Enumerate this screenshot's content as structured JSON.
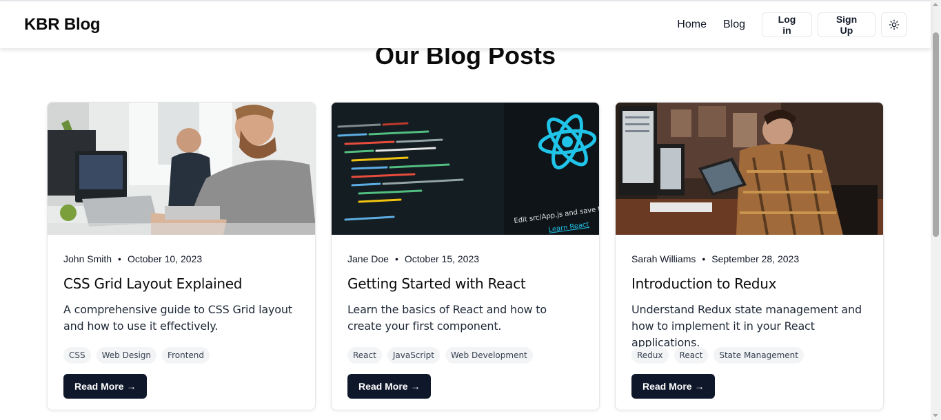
{
  "navbar": {
    "brand": "KBR Blog",
    "links": [
      "Home",
      "Blog"
    ],
    "login_label": "Log in",
    "signup_label": "Sign Up",
    "theme_icon": "sun-icon"
  },
  "page": {
    "title": "Our Blog Posts"
  },
  "posts": [
    {
      "author": "John Smith",
      "date": "October 10, 2023",
      "title": "CSS Grid Layout Explained",
      "description": "A comprehensive guide to CSS Grid layout and how to use it effectively.",
      "tags": [
        "CSS",
        "Web Design",
        "Frontend"
      ],
      "cta": "Read More →",
      "image": "office-developers-photo"
    },
    {
      "author": "Jane Doe",
      "date": "October 15, 2023",
      "title": "Getting Started with React",
      "description": "Learn the basics of React and how to create your first component.",
      "tags": [
        "React",
        "JavaScript",
        "Web Development"
      ],
      "cta": "Read More →",
      "image": "react-code-screen-photo",
      "image_text": [
        "Edit src/App.js and save to rel",
        "Learn React"
      ]
    },
    {
      "author": "Sarah Williams",
      "date": "September 28, 2023",
      "title": "Introduction to Redux",
      "description": "Understand Redux state management and how to implement it in your React applications.",
      "tags": [
        "Redux",
        "React",
        "State Management"
      ],
      "cta": "Read More →",
      "image": "workspace-tablet-photo"
    }
  ],
  "colors": {
    "button_dark": "#0f172a",
    "tag_bg": "#f3f4f6",
    "react_cyan": "#20c4e8"
  }
}
